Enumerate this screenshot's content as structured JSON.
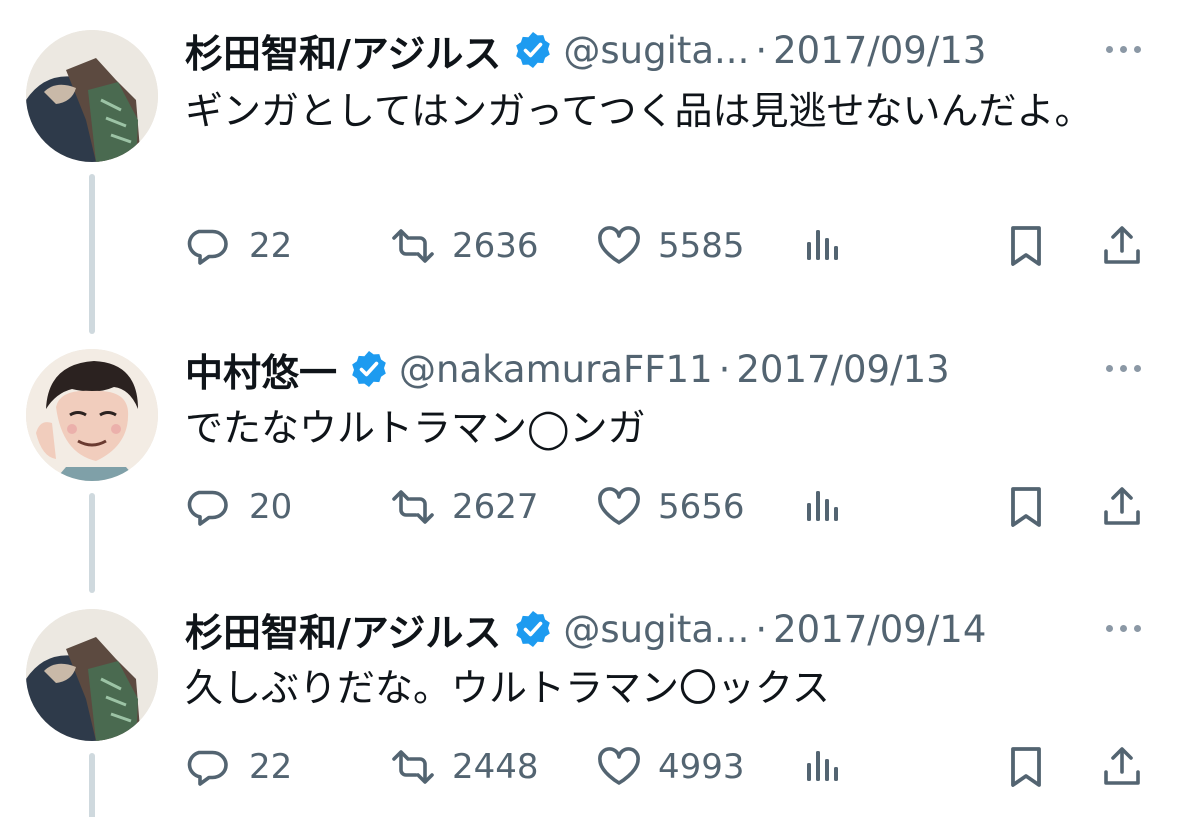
{
  "tweets": [
    {
      "display_name": "杉田智和/アジルス",
      "handle": "@sugita...",
      "separator": "·",
      "date": "2017/09/13",
      "text": "ギンガとしてはンガってつく品は見逃せないんだよ。",
      "replies": "22",
      "retweets": "2636",
      "likes": "5585"
    },
    {
      "display_name": "中村悠一",
      "handle": "@nakamuraFF11",
      "separator": "·",
      "date": "2017/09/13",
      "text": "でたなウルトラマン◯ンガ",
      "replies": "20",
      "retweets": "2627",
      "likes": "5656"
    },
    {
      "display_name": "杉田智和/アジルス",
      "handle": "@sugita...",
      "separator": "·",
      "date": "2017/09/14",
      "text": "久しぶりだな。ウルトラマン〇ックス",
      "replies": "22",
      "retweets": "2448",
      "likes": "4993"
    }
  ],
  "colors": {
    "text": "#0f1419",
    "muted": "#536471",
    "verified": "#1d9bf0",
    "thread_line": "#cfd9de"
  },
  "icons": [
    "reply-icon",
    "retweet-icon",
    "like-icon",
    "views-icon",
    "bookmark-icon",
    "share-icon",
    "verified-badge-icon",
    "more-icon"
  ]
}
